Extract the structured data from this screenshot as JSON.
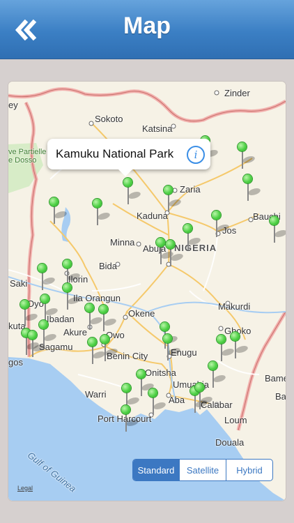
{
  "header": {
    "title": "Map",
    "back_icon": "double-chevron-left-icon"
  },
  "map": {
    "callout": {
      "text": "Kamuku National Park",
      "info_glyph": "i",
      "info_icon": "info-icon"
    },
    "labels": {
      "zinder": "Zinder",
      "sokoto": "Sokoto",
      "katsina": "Katsina",
      "park_partielle": "ve Partielle",
      "dosso": "e Dosso",
      "zaria": "Zaria",
      "kaduna": "Kaduna",
      "bauchi": "Bauchi",
      "minna": "Minna",
      "nigeria": "NIGERIA",
      "jos": "Jos",
      "bida": "Bida",
      "abuja": "Abuja",
      "saki": "Saki",
      "ilorin": "Ilorin",
      "oyo": "Oyo",
      "ila_orangun": "Ila Orangun",
      "ibadan": "Ibadan",
      "okene": "Okene",
      "makurdi": "Makurdi",
      "akure": "Akure",
      "owo": "Owo",
      "gboko": "Gboko",
      "sagamu": "Sagamu",
      "kuta": "kuta",
      "benin_city": "Benin City",
      "enugu": "Enugu",
      "gos": "gos",
      "onitsha": "Onitsha",
      "umuahia": "Umuahia",
      "bame": "Bame",
      "warri": "Warri",
      "aba": "Aba",
      "calabar": "Calabar",
      "ba": "Ba",
      "port_harcourt": "Port Harcourt",
      "loum": "Loum",
      "douala": "Douala",
      "ey": "ey",
      "gulf": "Gulf of Guinea"
    },
    "map_types": [
      "Standard",
      "Satellite",
      "Hybrid"
    ],
    "active_map_type": "Standard",
    "legal": "Legal",
    "pin_color": "#4fd146",
    "pin_icon": "map-pin-icon",
    "accent": "#3c78c2"
  }
}
